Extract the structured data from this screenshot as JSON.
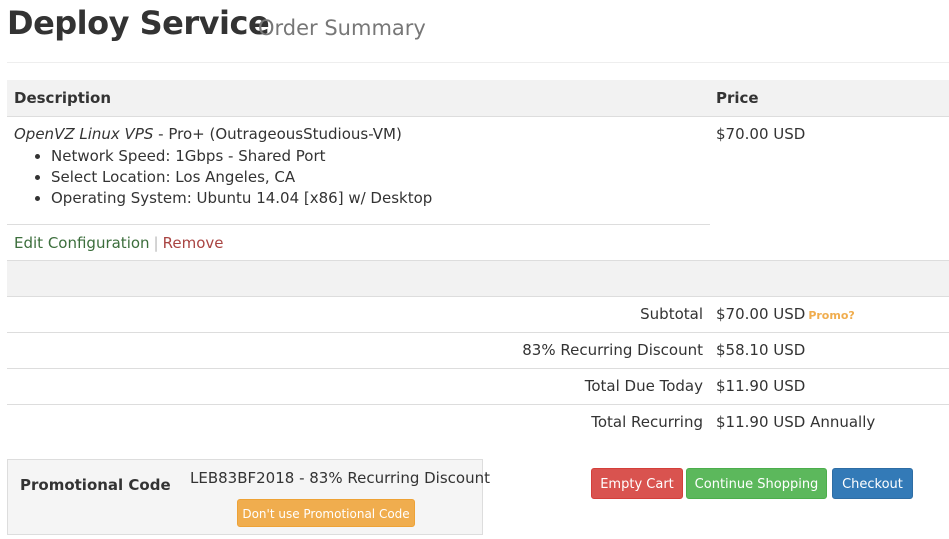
{
  "header": {
    "title": "Deploy Service",
    "subtitle": "Order Summary"
  },
  "table": {
    "columns": [
      "Description",
      "Price"
    ],
    "item": {
      "product_name": "OpenVZ Linux VPS",
      "product_plan": " - Pro+ (OutrageousStudious-VM)",
      "price": "$70.00 USD",
      "options": [
        "Network Speed: 1Gbps - Shared Port",
        "Select Location: Los Angeles, CA",
        "Operating System: Ubuntu 14.04 [x86] w/ Desktop"
      ],
      "edit_label": "Edit Configuration",
      "separator": "|",
      "remove_label": "Remove"
    }
  },
  "summary": {
    "subtotal_label": "Subtotal",
    "subtotal_value": "$70.00 USD",
    "promo_link": "Promo?",
    "discount_label": "83% Recurring Discount",
    "discount_value": "$58.10 USD",
    "due_today_label": "Total Due Today",
    "due_today_value": "$11.90 USD",
    "recurring_label": "Total Recurring",
    "recurring_value": "$11.90 USD Annually"
  },
  "promo": {
    "label": "Promotional Code",
    "applied_text": "LEB83BF2018 - 83% Recurring Discount",
    "remove_button": "Don't use Promotional Code"
  },
  "actions": {
    "empty_cart": "Empty Cart",
    "continue_shopping": "Continue Shopping",
    "checkout": "Checkout"
  },
  "colors": {
    "danger": "#d9534f",
    "success": "#5cb85c",
    "primary": "#337ab7",
    "warning": "#f0ad4e"
  }
}
